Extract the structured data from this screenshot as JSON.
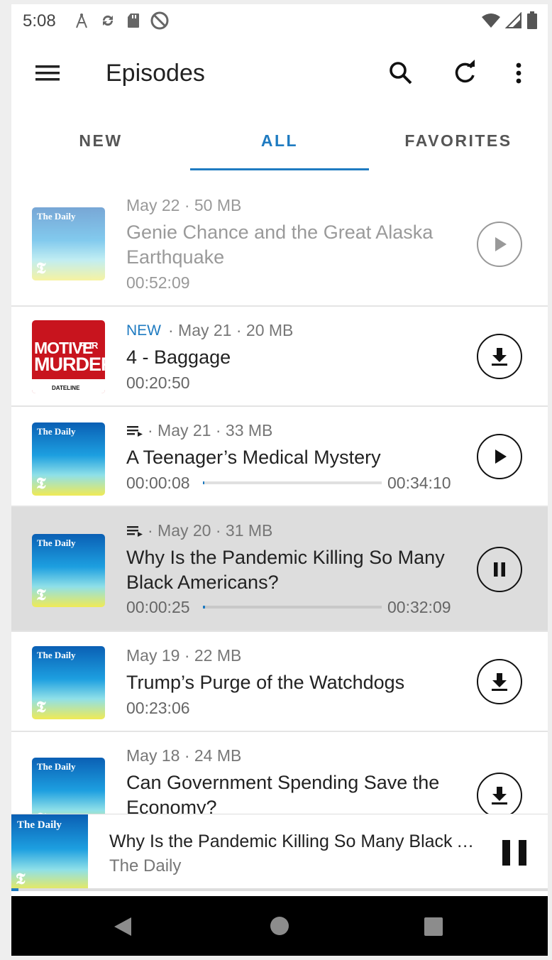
{
  "status_bar": {
    "time": "5:08"
  },
  "app_bar": {
    "title": "Episodes"
  },
  "tabs": [
    {
      "label": "NEW",
      "active": false
    },
    {
      "label": "ALL",
      "active": true
    },
    {
      "label": "FAVORITES",
      "active": false
    }
  ],
  "episodes": [
    {
      "artwork": "The Daily",
      "date_size": "May 22 · 50 MB",
      "title": "Genie Chance and the Great Alaska Earthquake",
      "duration": "00:52:09",
      "action": "play-icon",
      "played": true
    },
    {
      "artwork": "Motive for Murder",
      "badge": "NEW",
      "date_size": " · May 21 · 20 MB",
      "title": "4 - Baggage",
      "duration": "00:20:50",
      "action": "download-icon"
    },
    {
      "artwork": "The Daily",
      "queued": true,
      "date_size": " · May 21 · 33 MB",
      "title": "A Teenager’s Medical Mystery",
      "position": "00:00:08",
      "duration": "00:34:10",
      "progress": 0.004,
      "action": "play-icon"
    },
    {
      "artwork": "The Daily",
      "queued": true,
      "date_size": " · May 20 · 31 MB",
      "title": "Why Is the Pandemic Killing So Many Black Americans?",
      "position": "00:00:25",
      "duration": "00:32:09",
      "progress": 0.013,
      "action": "pause-icon",
      "selected": true
    },
    {
      "artwork": "The Daily",
      "date_size": "May 19 · 22 MB",
      "title": "Trump’s Purge of the Watchdogs",
      "duration": "00:23:06",
      "action": "download-icon"
    },
    {
      "artwork": "The Daily",
      "date_size": "May 18 · 24 MB",
      "title": "Can Government Spending Save the Economy?",
      "action": "download-icon"
    }
  ],
  "artwork_text": {
    "daily": "The Daily",
    "nyt": "𝕿",
    "motive_line1": "MOTIVE",
    "motive_for": "FOR",
    "motive_line2": "MURDER",
    "motive_brand": "DATELINE"
  },
  "mini_player": {
    "title": "Why Is the Pandemic Killing So Many Black Americans?",
    "podcast": "The Daily",
    "progress": 0.013
  },
  "colors": {
    "accent": "#1f7bc1",
    "selected_row": "#dddddd"
  }
}
